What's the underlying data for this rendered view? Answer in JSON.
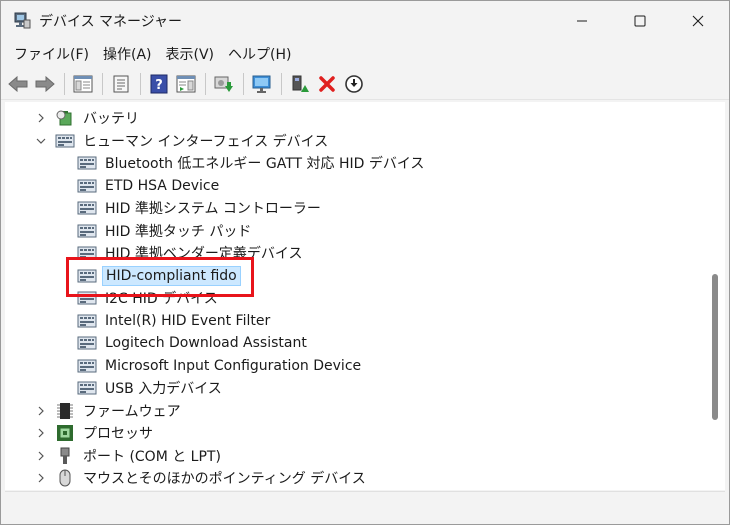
{
  "window": {
    "title": "デバイス マネージャー"
  },
  "menu": [
    {
      "label": "ファイル(F)"
    },
    {
      "label": "操作(A)"
    },
    {
      "label": "表示(V)"
    },
    {
      "label": "ヘルプ(H)"
    }
  ],
  "toolbar": {
    "buttons": [
      "back-icon",
      "forward-icon",
      "show-hide-console-tree-icon",
      "properties-icon",
      "help-icon",
      "action-pane-icon",
      "scan-hardware-icon",
      "monitor-icon",
      "update-driver-icon",
      "uninstall-icon",
      "disable-icon"
    ]
  },
  "tree": {
    "categories": [
      {
        "label": "バッテリ",
        "expanded": false
      },
      {
        "label": "ヒューマン インターフェイス デバイス",
        "expanded": true
      },
      {
        "label": "ファームウェア",
        "expanded": false
      },
      {
        "label": "プロセッサ",
        "expanded": false
      },
      {
        "label": "ポート (COM と LPT)",
        "expanded": false
      },
      {
        "label": "マウスとそのほかのポインティング デバイス",
        "expanded": false
      }
    ],
    "hid_devices": [
      {
        "label": "Bluetooth 低エネルギー GATT 対応 HID デバイス"
      },
      {
        "label": "ETD HSA Device"
      },
      {
        "label": "HID 準拠システム コントローラー"
      },
      {
        "label": "HID 準拠タッチ パッド"
      },
      {
        "label": "HID 準拠ベンダー定義デバイス"
      },
      {
        "label": "HID-compliant fido",
        "selected": true
      },
      {
        "label": "I2C HID デバイス"
      },
      {
        "label": "Intel(R) HID Event Filter"
      },
      {
        "label": "Logitech Download Assistant"
      },
      {
        "label": "Microsoft Input Configuration Device"
      },
      {
        "label": "USB 入力デバイス"
      }
    ]
  },
  "colors": {
    "selection_bg": "#cce8ff",
    "highlight_border": "#e8141b"
  }
}
